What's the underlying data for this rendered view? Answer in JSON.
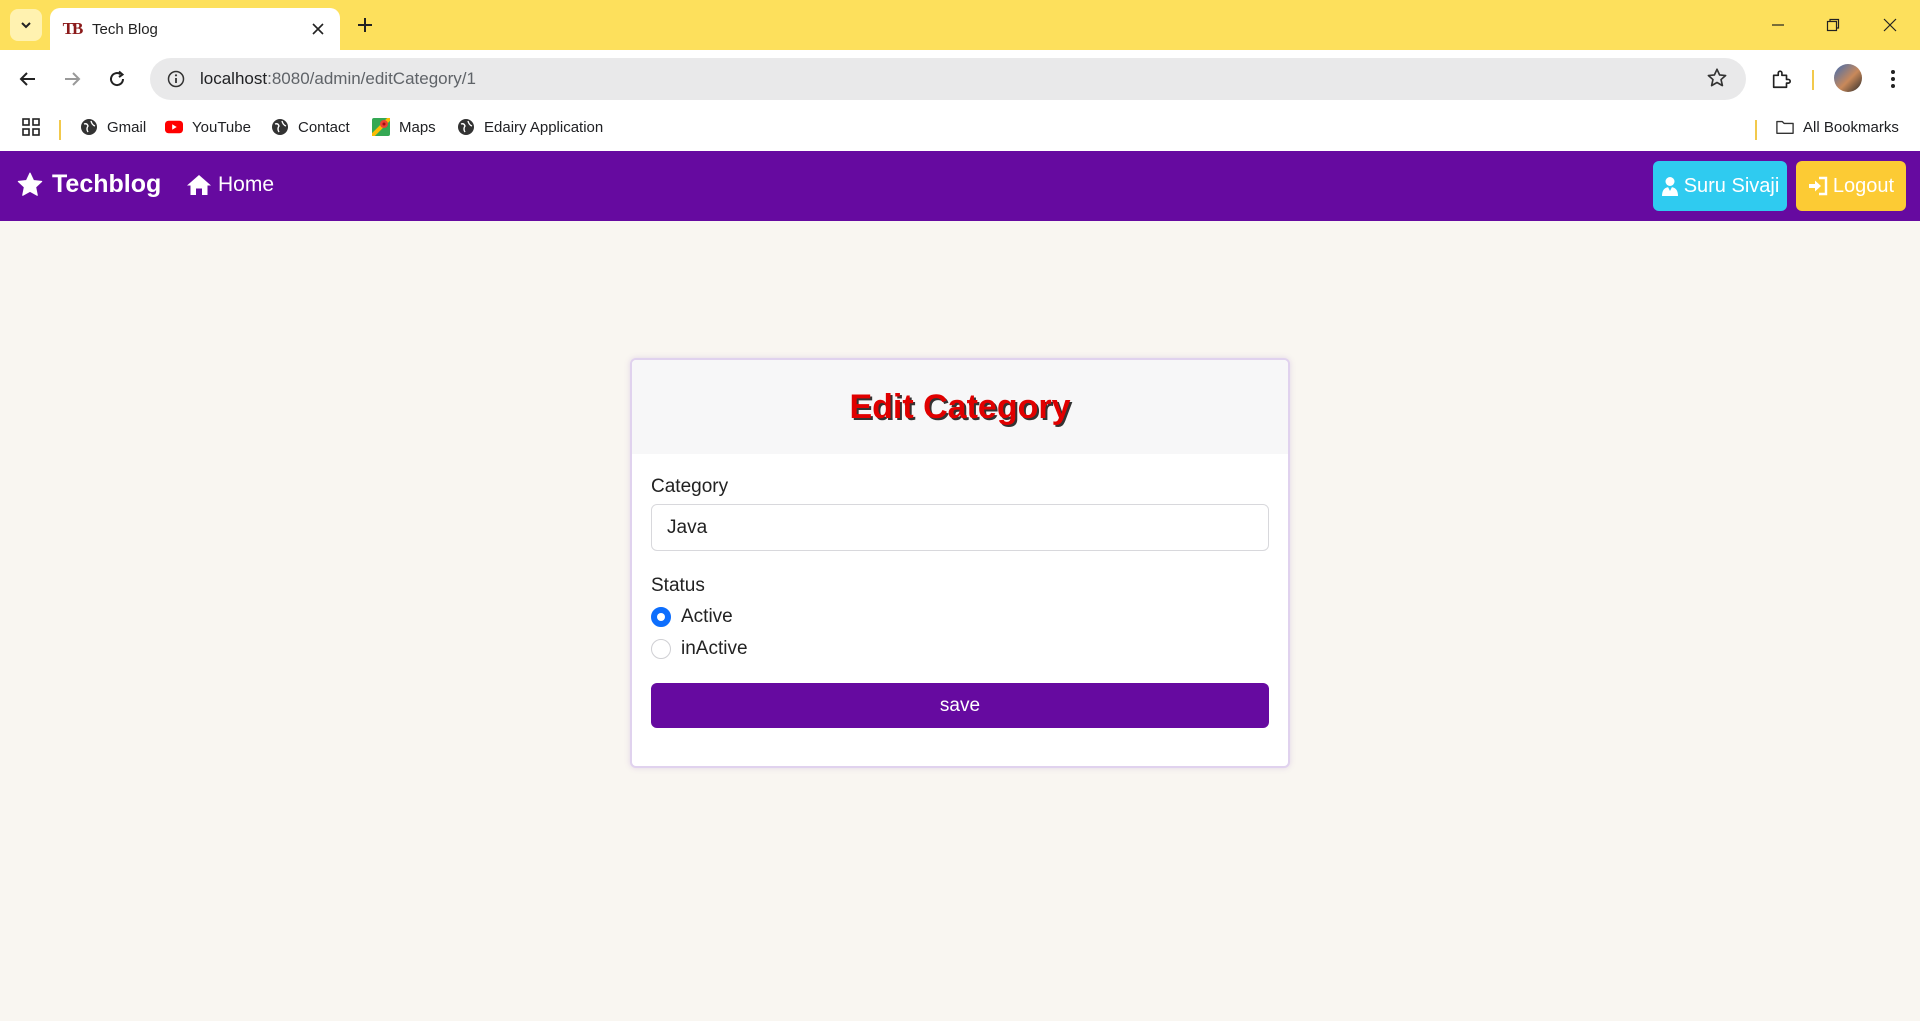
{
  "browser": {
    "tab_title": "Tech Blog",
    "url_host": "localhost",
    "url_rest": ":8080/admin/editCategory/1",
    "bookmarks": [
      "Gmail",
      "YouTube",
      "Contact",
      "Maps",
      "Edairy Application"
    ],
    "all_bookmarks_label": "All Bookmarks",
    "theme_color": "#fde05c"
  },
  "navbar": {
    "brand": "Techblog",
    "home_label": "Home",
    "user_label": "Suru Sivaji",
    "logout_label": "Logout",
    "bg_color": "#660aa0",
    "user_btn_color": "#2fcbf0",
    "logout_btn_color": "#fccb34"
  },
  "form": {
    "title": "Edit Category",
    "category_label": "Category",
    "category_value": "Java",
    "status_label": "Status",
    "status_options": [
      {
        "label": "Active",
        "checked": true
      },
      {
        "label": "inActive",
        "checked": false
      }
    ],
    "save_label": "save"
  },
  "icons": {
    "brand": "star-icon",
    "home": "home-icon",
    "user": "user-icon",
    "logout": "sign-in-icon"
  }
}
